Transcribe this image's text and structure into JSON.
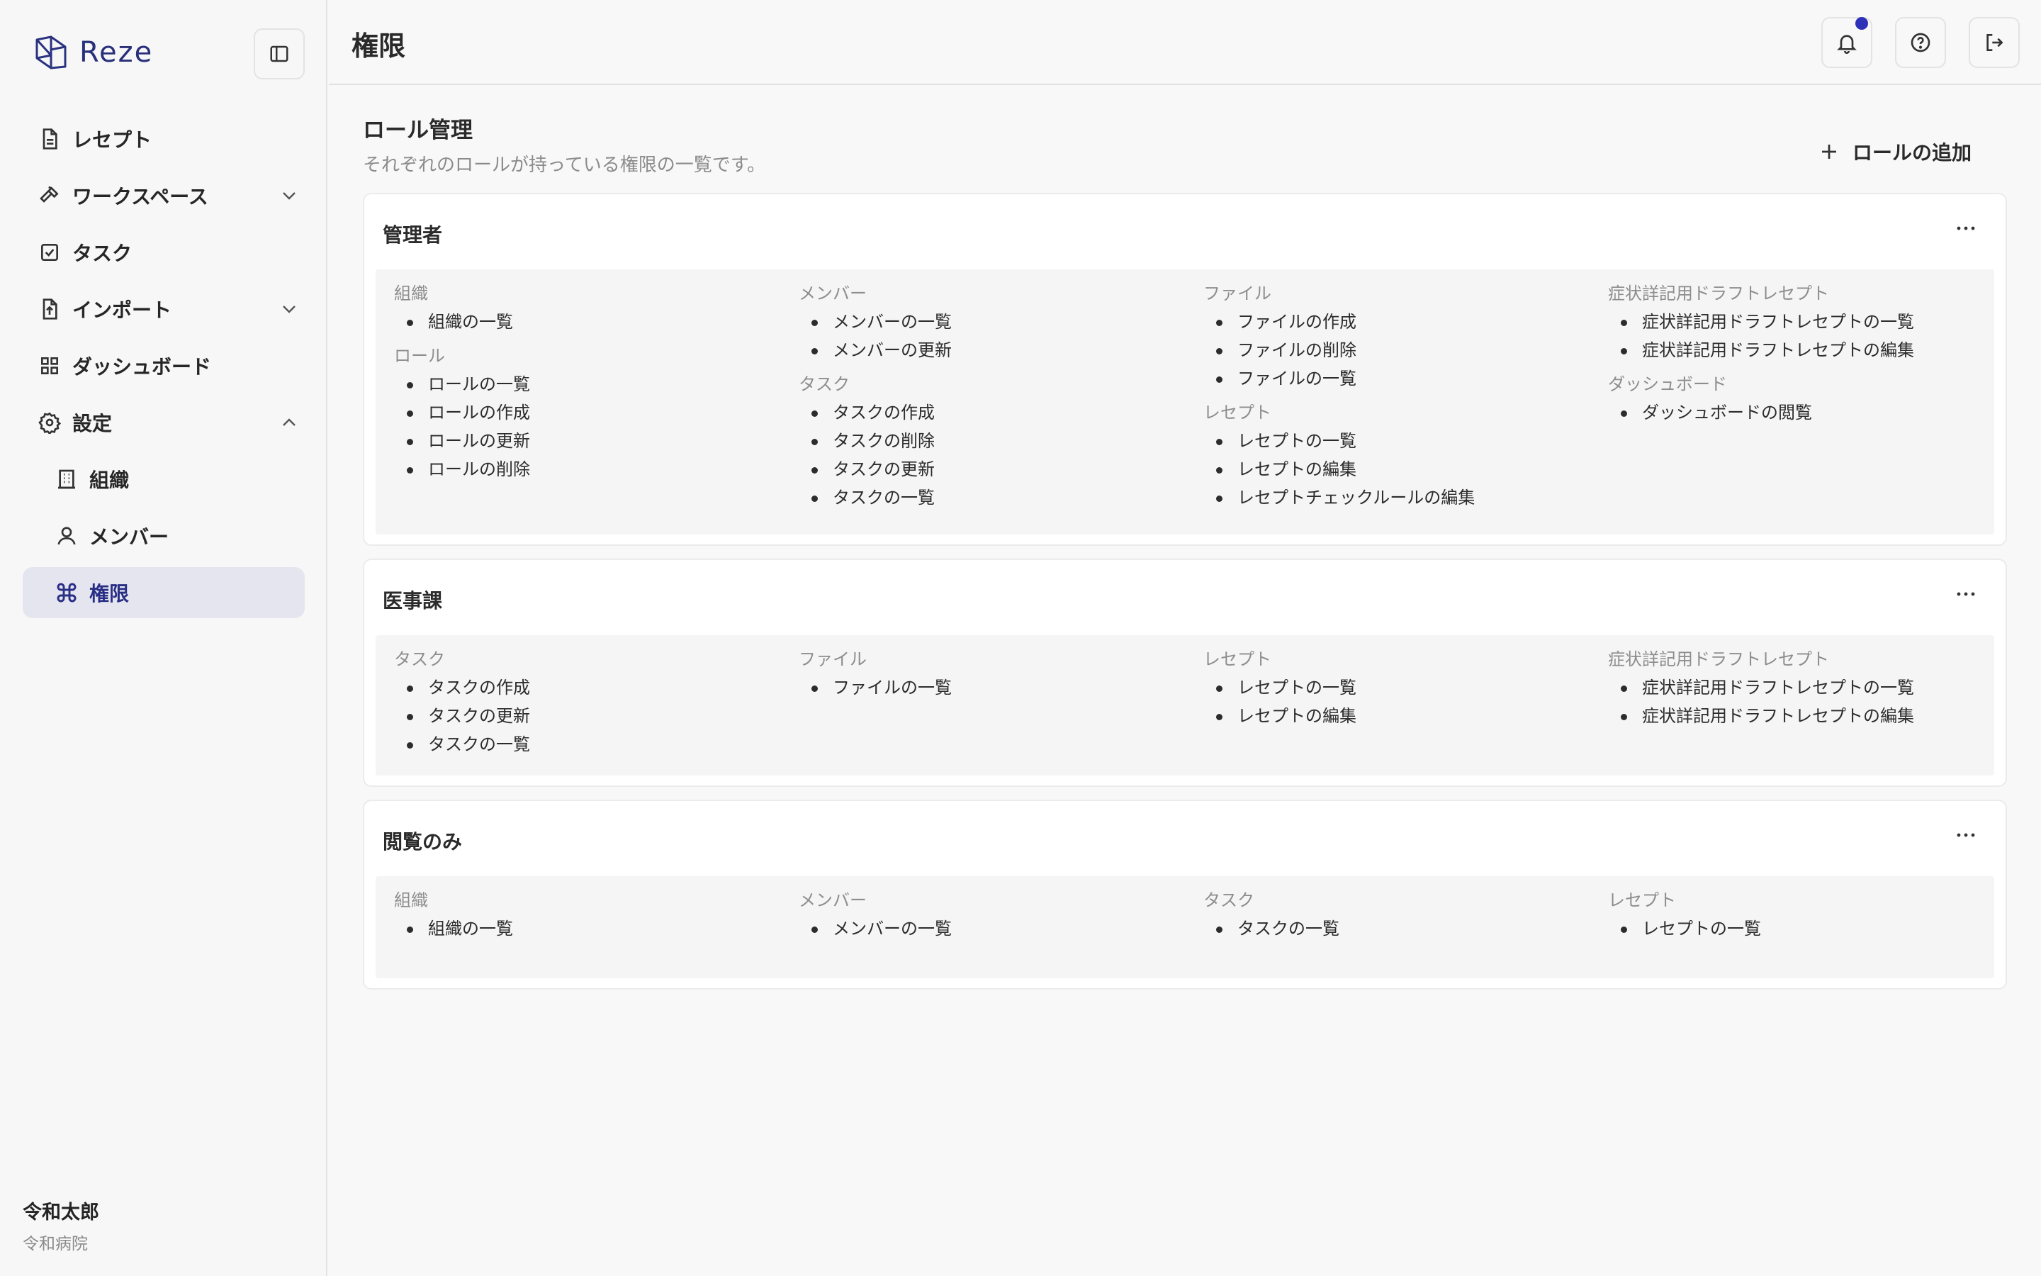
{
  "app": {
    "name": "Reze"
  },
  "sidebar": {
    "items": [
      {
        "label": "レセプト",
        "icon": "document-icon"
      },
      {
        "label": "ワークスペース",
        "icon": "hammer-icon",
        "expand": "down"
      },
      {
        "label": "タスク",
        "icon": "checkbox-icon"
      },
      {
        "label": "インポート",
        "icon": "file-upload-icon",
        "expand": "down"
      },
      {
        "label": "ダッシュボード",
        "icon": "dashboard-grid-icon"
      },
      {
        "label": "設定",
        "icon": "gear-icon",
        "expand": "up"
      }
    ],
    "subitems": [
      {
        "label": "組織",
        "icon": "building-icon"
      },
      {
        "label": "メンバー",
        "icon": "user-icon"
      },
      {
        "label": "権限",
        "icon": "command-icon",
        "active": true
      }
    ],
    "user": {
      "name": "令和太郎",
      "org": "令和病院"
    }
  },
  "header": {
    "title": "権限",
    "buttons": [
      "bell-icon",
      "help-icon",
      "logout-icon"
    ],
    "accent": "#2d32b8"
  },
  "main": {
    "title": "ロール管理",
    "description": "それぞれのロールが持っている権限の一覧です。",
    "add_label": "ロールの追加",
    "roles": [
      {
        "name": "管理者",
        "columns": [
          [
            {
              "group": "組織",
              "perms": [
                "組織の一覧"
              ]
            },
            {
              "group": "ロール",
              "perms": [
                "ロールの一覧",
                "ロールの作成",
                "ロールの更新",
                "ロールの削除"
              ]
            }
          ],
          [
            {
              "group": "メンバー",
              "perms": [
                "メンバーの一覧",
                "メンバーの更新"
              ]
            },
            {
              "group": "タスク",
              "perms": [
                "タスクの作成",
                "タスクの削除",
                "タスクの更新",
                "タスクの一覧"
              ]
            }
          ],
          [
            {
              "group": "ファイル",
              "perms": [
                "ファイルの作成",
                "ファイルの削除",
                "ファイルの一覧"
              ]
            },
            {
              "group": "レセプト",
              "perms": [
                "レセプトの一覧",
                "レセプトの編集",
                "レセプトチェックルールの編集"
              ]
            }
          ],
          [
            {
              "group": "症状詳記用ドラフトレセプト",
              "perms": [
                "症状詳記用ドラフトレセプトの一覧",
                "症状詳記用ドラフトレセプトの編集"
              ]
            },
            {
              "group": "ダッシュボード",
              "perms": [
                "ダッシュボードの閲覧"
              ]
            }
          ]
        ]
      },
      {
        "name": "医事課",
        "columns": [
          [
            {
              "group": "タスク",
              "perms": [
                "タスクの作成",
                "タスクの更新",
                "タスクの一覧"
              ]
            }
          ],
          [
            {
              "group": "ファイル",
              "perms": [
                "ファイルの一覧"
              ]
            }
          ],
          [
            {
              "group": "レセプト",
              "perms": [
                "レセプトの一覧",
                "レセプトの編集"
              ]
            }
          ],
          [
            {
              "group": "症状詳記用ドラフトレセプト",
              "perms": [
                "症状詳記用ドラフトレセプトの一覧",
                "症状詳記用ドラフトレセプトの編集"
              ]
            }
          ]
        ]
      },
      {
        "name": "閲覧のみ",
        "columns": [
          [
            {
              "group": "組織",
              "perms": [
                "組織の一覧"
              ]
            }
          ],
          [
            {
              "group": "メンバー",
              "perms": [
                "メンバーの一覧"
              ]
            }
          ],
          [
            {
              "group": "タスク",
              "perms": [
                "タスクの一覧"
              ]
            }
          ],
          [
            {
              "group": "レセプト",
              "perms": [
                "レセプトの一覧"
              ]
            }
          ]
        ]
      }
    ]
  }
}
